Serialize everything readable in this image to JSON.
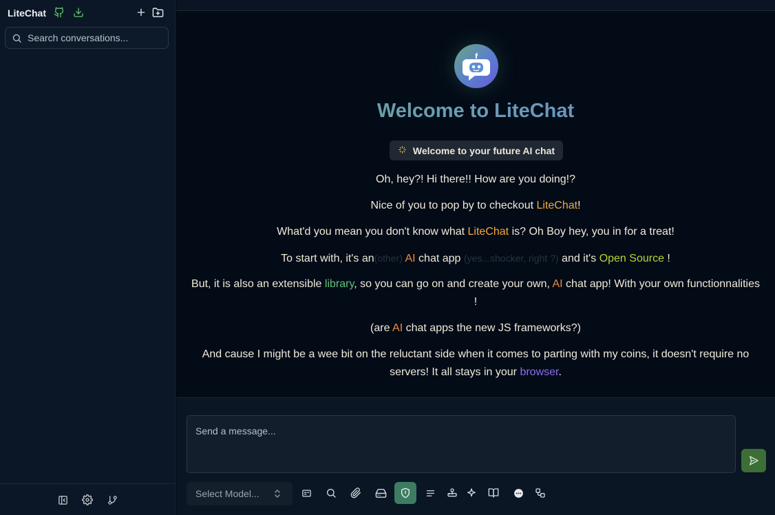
{
  "sidebar": {
    "app_title": "LiteChat",
    "search_placeholder": "Search conversations..."
  },
  "welcome": {
    "title": "Welcome to LiteChat",
    "pill": "Welcome to your future AI chat",
    "p1": "Oh, hey?! Hi there!! How are you doing!?",
    "p2_pre": "Nice of you to pop by to checkout ",
    "p2_brand": "LiteChat",
    "p2_post": "!",
    "p3_pre": "What'd you mean you don't know what ",
    "p3_brand": "LiteChat",
    "p3_post": " is? Oh Boy hey, you in for a treat!",
    "p4_a": "To start with, it's an",
    "p4_dim1": "(other)",
    "p4_ai": "AI",
    "p4_b": " chat app ",
    "p4_dim2": "(yes...shocker, right ?)",
    "p4_c": " and it's ",
    "p4_os": "Open Source",
    "p4_d": " !",
    "p5_a": "But, it is also an extensible ",
    "p5_lib": "library",
    "p5_b": ", so you can go on and create your own, ",
    "p5_ai": "AI",
    "p5_c": " chat app! With your own functionnalities !",
    "p6_a": "(are ",
    "p6_ai": "AI",
    "p6_b": " chat apps the new JS frameworks?)",
    "p7_a": "And cause I might be a wee bit on the reluctant side when it comes to parting with my coins, it doesn't require no servers! It all stays in your ",
    "p7_browser": "browser",
    "p7_b": "."
  },
  "composer": {
    "placeholder": "Send a message...",
    "model_select": "Select Model..."
  },
  "icons": {
    "github": "github-icon",
    "download": "download-icon",
    "new_chat": "plus-icon",
    "new_folder": "folder-plus-icon",
    "search": "search-icon",
    "collapse": "sidebar-collapse-icon",
    "settings": "gear-icon",
    "git": "git-branch-icon",
    "send": "send-icon"
  },
  "colors": {
    "brand_orange": "#f2a93a",
    "accent_green": "#3d7c62",
    "send_green": "#3c6e36"
  }
}
